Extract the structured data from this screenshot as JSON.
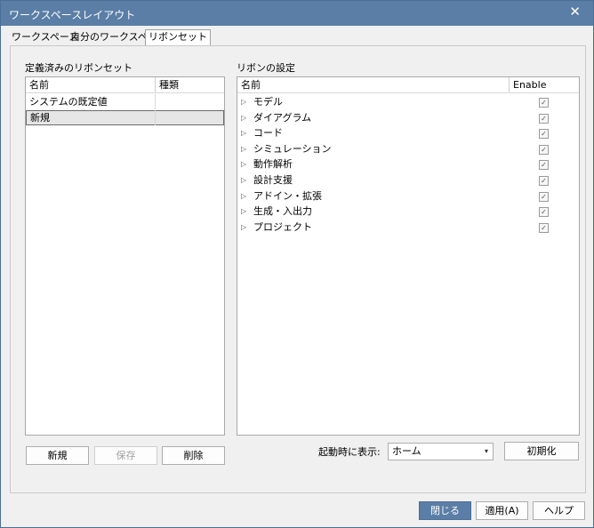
{
  "window": {
    "title": "ワークスペースレイアウト",
    "close_glyph": "✕"
  },
  "tabs": [
    {
      "label": "ワークスペース"
    },
    {
      "label": "自分のワークスペース"
    },
    {
      "label": "リボンセット"
    }
  ],
  "left": {
    "group_label": "定義済みのリボンセット",
    "columns": [
      "名前",
      "種類"
    ],
    "rows": [
      {
        "name": "システムの既定値",
        "type": ""
      },
      {
        "name": "新規",
        "type": ""
      }
    ],
    "buttons": {
      "new": "新規",
      "save": "保存",
      "delete": "削除"
    }
  },
  "right": {
    "group_label": "リボンの設定",
    "columns": [
      "名前",
      "Enable"
    ],
    "expand_glyph": "▷",
    "check_glyph": "✓",
    "items": [
      {
        "label": "モデル",
        "enabled": true
      },
      {
        "label": "ダイアグラム",
        "enabled": true
      },
      {
        "label": "コード",
        "enabled": true
      },
      {
        "label": "シミュレーション",
        "enabled": true
      },
      {
        "label": "動作解析",
        "enabled": true
      },
      {
        "label": "設計支援",
        "enabled": true
      },
      {
        "label": "アドイン・拡張",
        "enabled": true
      },
      {
        "label": "生成・入出力",
        "enabled": true
      },
      {
        "label": "プロジェクト",
        "enabled": true
      }
    ],
    "startup_label": "起動時に表示:",
    "startup_value": "ホーム",
    "dropdown_glyph": "▾",
    "reset_button": "初期化"
  },
  "footer": {
    "close": "閉じる",
    "apply": "適用(A)",
    "help": "ヘルプ"
  },
  "colors": {
    "titlebar": "#5a7ea6",
    "primary_button": "#5a7ea6"
  }
}
